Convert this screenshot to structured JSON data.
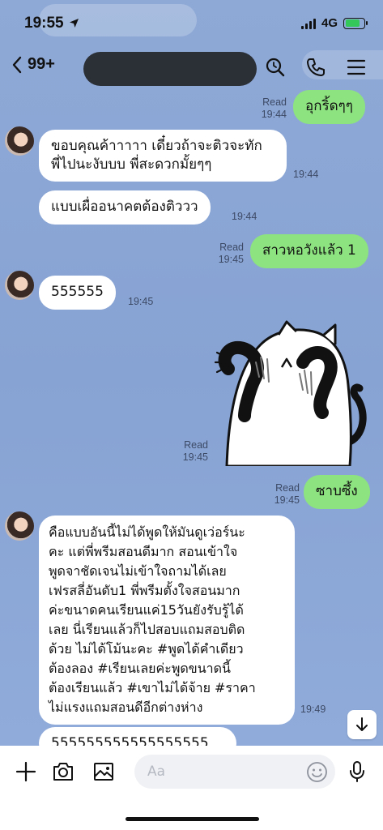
{
  "status_bar": {
    "time": "19:55",
    "network": "4G",
    "battery_percent": 80
  },
  "header": {
    "back_count": "99+",
    "chat_name": ""
  },
  "messages": [
    {
      "direction": "out",
      "text": "อุกริ้ดๆๆ",
      "status": "Read",
      "time": "19:44"
    },
    {
      "direction": "in",
      "text": "ขอบคุณค้าาาาา เดี๋ยวถ้าจะติวจะทัก\nพี่ไปนะงับบบ พี่สะดวกมั้ยๆๆ",
      "time": "19:44"
    },
    {
      "direction": "in",
      "text": "แบบเผื่ออนาคตต้องติววว",
      "time": "19:44"
    },
    {
      "direction": "out",
      "text": "สาวหอวังแล้ว 1",
      "status": "Read",
      "time": "19:45"
    },
    {
      "direction": "in",
      "text": "555555",
      "time": "19:45"
    },
    {
      "direction": "out",
      "type": "sticker",
      "sticker": "crying-cat-sticker",
      "status": "Read",
      "time": "19:45"
    },
    {
      "direction": "out",
      "text": "ซาบซึ้ง",
      "status": "Read",
      "time": "19:45"
    },
    {
      "direction": "in",
      "text": "คือแบบอันนี้ไม่ได้พูดให้มันดูเว่อร์นะ\nคะ แต่พี่พรีมสอนดีมาก สอนเข้าใจ\nพูดจาชัดเจนไม่เข้าใจถามได้เลย\nเฟรสลี่อันดับ1 พี่พรีมตั้งใจสอนมาก\nค่ะขนาดคนเรียนแค่15วันยังรับรู้ได้\nเลย นี่เรียนแล้วก็ไปสอบแถมสอบติด\nด้วย ไม่ได้โม้นะคะ #พูดได้คำเดียว\nต้องลอง #เรียนเลยค่ะพูดขนาดนี้\nต้องเรียนแล้ว #เขาไม่ได้จ้าย #ราคา\nไม่แรงแถมสอนดีอีกต่างห่าง",
      "time": "19:49"
    },
    {
      "direction": "in",
      "text": "555555555555555555"
    }
  ],
  "composer": {
    "placeholder": "Aa"
  },
  "icons": {
    "back": "chevron-left-icon",
    "search": "search-icon",
    "call": "phone-icon",
    "menu": "menu-icon",
    "add": "plus-icon",
    "camera": "camera-icon",
    "gallery": "image-icon",
    "emoji": "smiley-icon",
    "mic": "microphone-icon",
    "scroll_down": "arrow-down-icon"
  },
  "colors": {
    "background": "#8fa9d6",
    "outgoing_bubble": "#8de37f",
    "incoming_bubble": "#ffffff",
    "battery": "#34c759"
  }
}
